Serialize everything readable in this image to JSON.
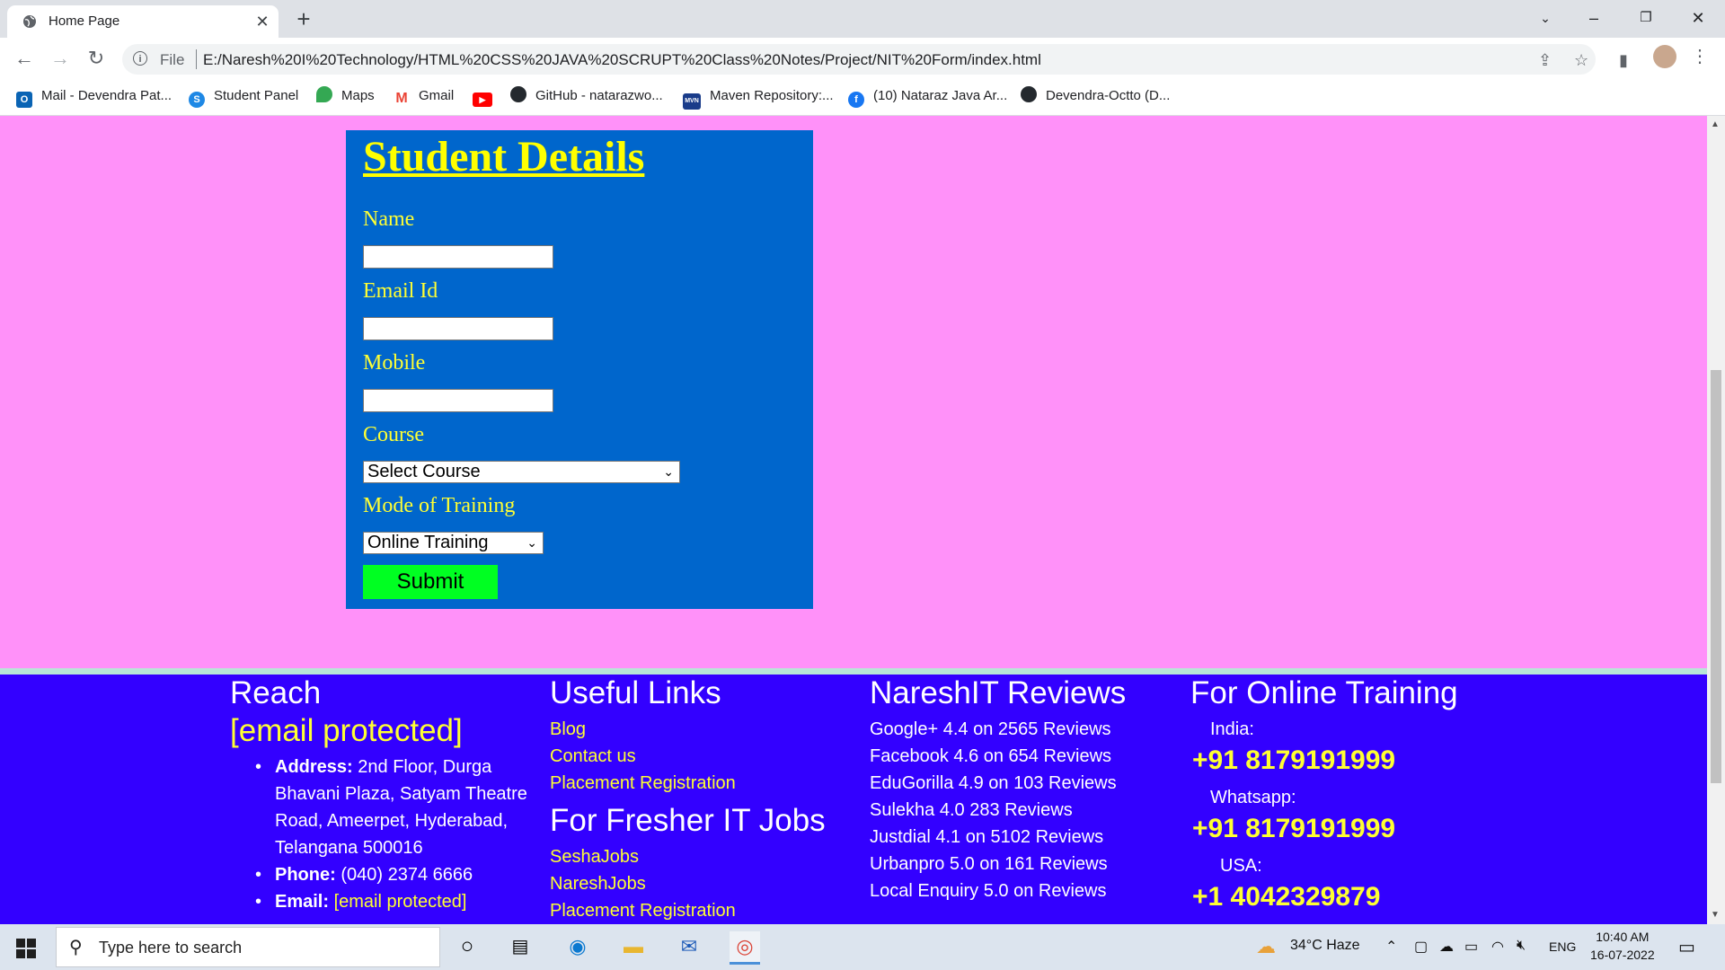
{
  "browser": {
    "tab_title": "Home Page",
    "url_scheme_label": "File",
    "url": "E:/Naresh%20I%20Technology/HTML%20CSS%20JAVA%20SCRUPT%20Class%20Notes/Project/NIT%20Form/index.html",
    "bookmarks": [
      {
        "label": "Mail - Devendra Pat...",
        "icon": "outlook-icon",
        "color": "#0a64b4"
      },
      {
        "label": "Student Panel",
        "icon": "student-panel-icon",
        "color": "#1e88e5"
      },
      {
        "label": "Maps",
        "icon": "maps-icon",
        "color": "#34a853"
      },
      {
        "label": "Gmail",
        "icon": "gmail-icon",
        "color": "#ea4335"
      },
      {
        "label": "",
        "icon": "youtube-icon",
        "color": "#ff0000"
      },
      {
        "label": "GitHub - natarazwo...",
        "icon": "github-icon",
        "color": "#24292e"
      },
      {
        "label": "Maven Repository:...",
        "icon": "maven-icon",
        "color": "#1a3c8a"
      },
      {
        "label": "(10) Nataraz Java Ar...",
        "icon": "facebook-icon",
        "color": "#1877f2"
      },
      {
        "label": "Devendra-Octto (D...",
        "icon": "github-icon",
        "color": "#24292e"
      }
    ]
  },
  "form": {
    "title": "Student Details",
    "name_label": "Name",
    "email_label": "Email Id",
    "mobile_label": "Mobile",
    "course_label": "Course",
    "course_selected": "Select Course",
    "mode_label": "Mode of Training",
    "mode_selected": "Online Training",
    "submit_label": "Submit"
  },
  "footer": {
    "reach": {
      "heading": "Reach",
      "email_link": "[email protected]",
      "address_label": "Address:",
      "address_lines": [
        "2nd Floor, Durga",
        "Bhavani Plaza, Satyam Theatre",
        "Road, Ameerpet, Hyderabad,",
        "Telangana 500016"
      ],
      "phone_label": "Phone:",
      "phone_value": "(040) 2374 6666",
      "email_label": "Email:",
      "email_value": "[email protected]"
    },
    "useful_links": {
      "heading": "Useful Links",
      "links": [
        "Blog",
        "Contact us",
        "Placement Registration"
      ]
    },
    "fresher": {
      "heading": "For Fresher IT Jobs",
      "links": [
        "SeshaJobs",
        "NareshJobs",
        "Placement Registration"
      ]
    },
    "reviews": {
      "heading": "NareshIT Reviews",
      "items": [
        "Google+ 4.4 on 2565 Reviews",
        "Facebook 4.6 on 654 Reviews",
        "EduGorilla 4.9 on 103 Reviews",
        "Sulekha 4.0 283 Reviews",
        "Justdial 4.1 on 5102 Reviews",
        "Urbanpro 5.0 on 161 Reviews",
        "Local Enquiry 5.0 on Reviews"
      ]
    },
    "online": {
      "heading": "For Online Training",
      "india_label": "India:",
      "india_phone": "+91 8179191999",
      "whatsapp_label": "Whatsapp:",
      "whatsapp_phone": "+91 8179191999",
      "usa_label": "USA:",
      "usa_phone": "+1 4042329879"
    }
  },
  "taskbar": {
    "search_placeholder": "Type here to search",
    "weather": "34°C  Haze",
    "language": "ENG",
    "time": "10:40 AM",
    "date": "16-07-2022"
  }
}
